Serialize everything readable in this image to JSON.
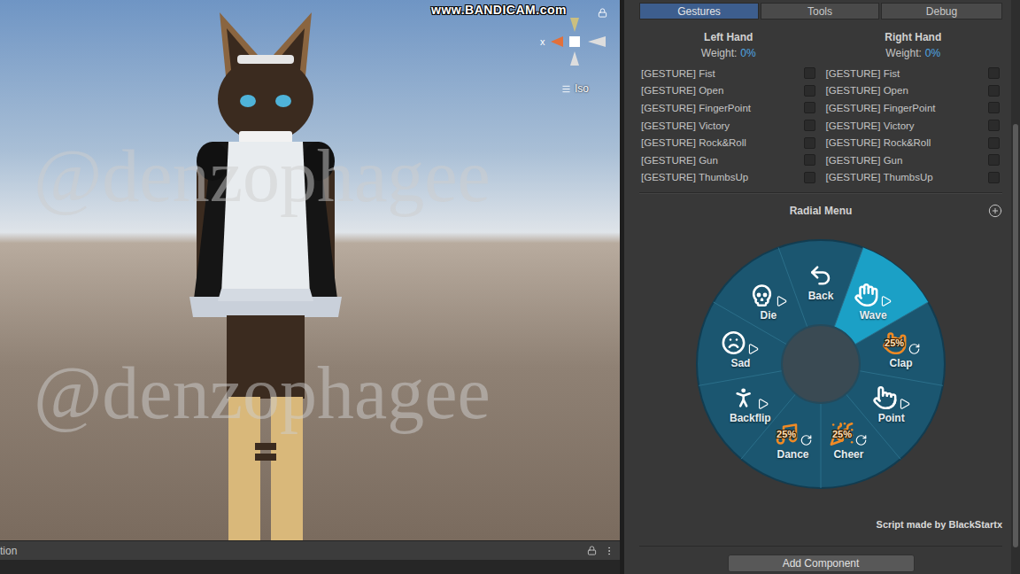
{
  "viewport": {
    "recorder_watermark": "www.BANDICAM.com",
    "axis_label": "x",
    "projection": "Iso",
    "watermarks": [
      "@denzophagee",
      "@denzophagee"
    ],
    "status_text": "tion"
  },
  "tabs": [
    {
      "label": "Gestures",
      "selected": true
    },
    {
      "label": "Tools",
      "selected": false
    },
    {
      "label": "Debug",
      "selected": false
    }
  ],
  "hands": [
    {
      "title": "Left Hand",
      "weight_label": "Weight:",
      "weight": "0%",
      "gestures": [
        {
          "label": "[GESTURE] Fist",
          "checked": false
        },
        {
          "label": "[GESTURE] Open",
          "checked": false
        },
        {
          "label": "[GESTURE] FingerPoint",
          "checked": false
        },
        {
          "label": "[GESTURE] Victory",
          "checked": false
        },
        {
          "label": "[GESTURE] Rock&Roll",
          "checked": false
        },
        {
          "label": "[GESTURE] Gun",
          "checked": false
        },
        {
          "label": "[GESTURE] ThumbsUp",
          "checked": false
        }
      ]
    },
    {
      "title": "Right Hand",
      "weight_label": "Weight:",
      "weight": "0%",
      "gestures": [
        {
          "label": "[GESTURE] Fist",
          "checked": false
        },
        {
          "label": "[GESTURE] Open",
          "checked": false
        },
        {
          "label": "[GESTURE] FingerPoint",
          "checked": false
        },
        {
          "label": "[GESTURE] Victory",
          "checked": false
        },
        {
          "label": "[GESTURE] Rock&Roll",
          "checked": false
        },
        {
          "label": "[GESTURE] Gun",
          "checked": false
        },
        {
          "label": "[GESTURE] ThumbsUp",
          "checked": false
        }
      ]
    }
  ],
  "radial_menu": {
    "title": "Radial Menu",
    "items": [
      {
        "label": "Back",
        "kind": "back",
        "selected": false
      },
      {
        "label": "Wave",
        "kind": "play",
        "selected": true
      },
      {
        "label": "Clap",
        "kind": "toggle",
        "value": "25%",
        "selected": false
      },
      {
        "label": "Point",
        "kind": "play",
        "selected": false
      },
      {
        "label": "Cheer",
        "kind": "toggle",
        "value": "25%",
        "selected": false
      },
      {
        "label": "Dance",
        "kind": "toggle",
        "value": "25%",
        "selected": false
      },
      {
        "label": "Backflip",
        "kind": "play",
        "selected": false
      },
      {
        "label": "Sad",
        "kind": "play",
        "selected": false
      },
      {
        "label": "Die",
        "kind": "play",
        "selected": false
      }
    ]
  },
  "footer": "Script made by BlackStartx",
  "buttons": [
    "Add Component"
  ]
}
